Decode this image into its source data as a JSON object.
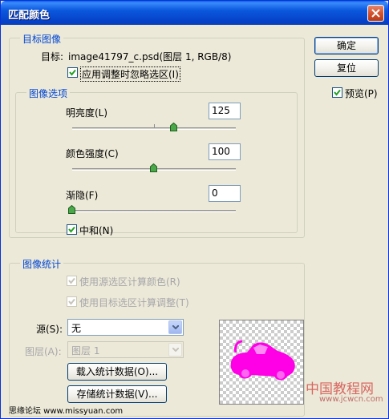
{
  "window": {
    "title": "匹配颜色"
  },
  "target": {
    "legend": "目标图像",
    "target_label": "目标:",
    "target_value": "image41797_c.psd(图层 1, RGB/8)",
    "ignore_selection_label": "应用调整时忽略选区(I)",
    "ignore_selection_checked": true
  },
  "options": {
    "legend": "图像选项",
    "luminance_label": "明亮度(L)",
    "luminance_value": "125",
    "color_intensity_label": "颜色强度(C)",
    "color_intensity_value": "100",
    "fade_label": "渐隐(F)",
    "fade_value": "0",
    "neutralize_label": "中和(N)",
    "neutralize_checked": true
  },
  "stats": {
    "legend": "图像统计",
    "use_source_selection_label": "使用源选区计算颜色(R)",
    "use_target_selection_label": "使用目标选区计算调整(T)",
    "source_label": "源(S):",
    "source_value": "无",
    "layer_label": "图层(A):",
    "layer_value": "图层 1",
    "load_button": "载入统计数据(O)...",
    "save_button": "存储统计数据(V)..."
  },
  "buttons": {
    "ok": "确定",
    "reset": "复位"
  },
  "preview": {
    "label": "预览(P)",
    "checked": true
  },
  "watermark": {
    "left": "思缘论坛  www.missyuan.com",
    "right_cn": "中国教程网",
    "right_url": "www.jcwcn.com"
  },
  "colors": {
    "accent": "#0046d5",
    "shape": "#ff00e6"
  }
}
